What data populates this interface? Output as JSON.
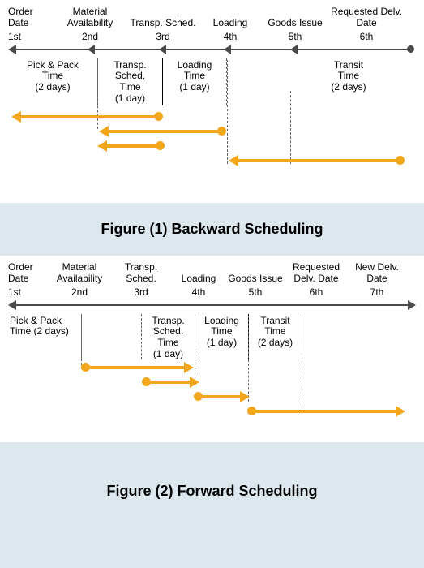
{
  "figure1": {
    "caption": "Figure (1) Backward Scheduling",
    "headers": [
      "Order Date",
      "Material Availability",
      "Transp. Sched.",
      "Loading",
      "Goods Issue",
      "Requested Delv. Date"
    ],
    "ordinals": [
      "1st",
      "2nd",
      "3rd",
      "4th",
      "5th",
      "6th"
    ],
    "segments": {
      "pickpack": "Pick & Pack\nTime\n(2 days)",
      "tsched": "Transp.\nSched.\nTime\n(1 day)",
      "loading": "Loading\nTime\n(1 day)",
      "transit": "Transit\nTime\n(2 days)"
    }
  },
  "figure2": {
    "caption": "Figure (2) Forward Scheduling",
    "headers": [
      "Order Date",
      "Material Availability",
      "Transp. Sched.",
      "Loading",
      "Goods Issue",
      "Requested Delv. Date",
      "New Delv. Date"
    ],
    "ordinals": [
      "1st",
      "2nd",
      "3rd",
      "4th",
      "5th",
      "6th",
      "7th"
    ],
    "segments": {
      "pickpack": "Pick & Pack\nTime (2 days)",
      "tsched": "Transp.\nSched.\nTime\n(1 day)",
      "loading": "Loading\nTime\n(1 day)",
      "transit": "Transit\nTime\n(2 days)"
    }
  }
}
